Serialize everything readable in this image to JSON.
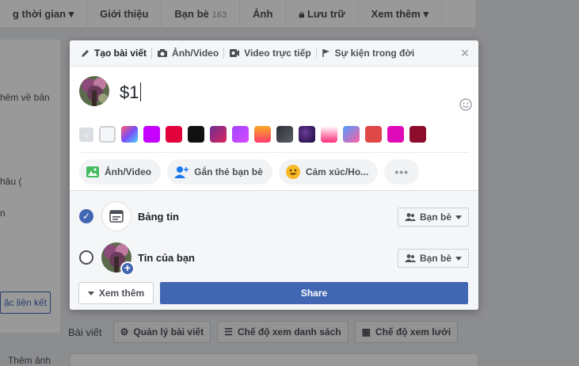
{
  "background": {
    "tabs": [
      {
        "label": "g thời gian",
        "chevron": true
      },
      {
        "label": "Giới thiệu"
      },
      {
        "label": "Bạn bè",
        "count": "163"
      },
      {
        "label": "Ảnh"
      },
      {
        "label": "Lưu trữ",
        "lock": true
      },
      {
        "label": "Xem thêm",
        "chevron": true
      }
    ],
    "left_texts": [
      "hêm về bản",
      "hâu (",
      "n"
    ],
    "link_box": "ặc liên kết",
    "posts_label": "Bài viết",
    "manage_posts": "Quản lý bài viết",
    "list_view": "Chế độ xem danh sách",
    "grid_view": "Chế độ xem lưới",
    "add_photo": "Thêm ảnh"
  },
  "composer": {
    "header_tabs": [
      {
        "label": "Tạo bài viết",
        "icon": "pencil-icon"
      },
      {
        "label": "Ảnh/Video",
        "icon": "camera-icon"
      },
      {
        "label": "Video trực tiếp",
        "icon": "video-icon"
      },
      {
        "label": "Sự kiện trong đời",
        "icon": "flag-icon"
      }
    ],
    "close_icon": "close-icon",
    "text": "$1",
    "swatch_colors": [
      "#f2f3f5",
      "gradient-multi",
      "#c600ff",
      "#e2013b",
      "#111111",
      "gradient-purple-red",
      "gradient-violet",
      "gradient-orange",
      "gradient-gray",
      "gradient-space",
      "gradient-pink",
      "gradient-blue-pink",
      "#e04848",
      "#e00bb8",
      "#8e0d2d"
    ],
    "actions": [
      {
        "label": "Ảnh/Video",
        "icon": "photo-icon"
      },
      {
        "label": "Gắn thẻ bạn bè",
        "icon": "tag-friend-icon"
      },
      {
        "label": "Cảm xúc/Ho...",
        "icon": "smiley-icon"
      }
    ],
    "more_actions": "•••",
    "audience": [
      {
        "label": "Bảng tin",
        "checked": true,
        "privacy": "Bạn bè"
      },
      {
        "label": "Tin của bạn",
        "checked": false,
        "privacy": "Bạn bè"
      }
    ],
    "see_more": "Xem thêm",
    "share": "Share"
  },
  "colors": {
    "accent": "#4267b2",
    "header_bg": "#f5f6f7",
    "border": "#dddfe2"
  }
}
